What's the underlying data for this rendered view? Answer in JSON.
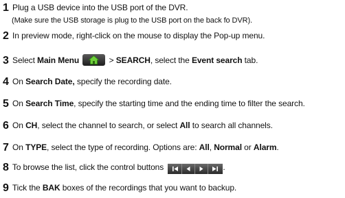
{
  "steps": [
    {
      "num": "1",
      "parts": [
        "Plug a USB device into the USB port of the DVR."
      ],
      "note": "(Make sure the USB storage is plug to the USB port on the back fo DVR)."
    },
    {
      "num": "2",
      "parts": [
        "In preview mode, right-click on the mouse to display the Pop-up menu."
      ]
    },
    {
      "num": "3",
      "parts": [
        "Select ",
        "Main Menu",
        " > ",
        "SEARCH",
        ", select the ",
        "Event search",
        " tab."
      ]
    },
    {
      "num": "4",
      "parts": [
        "On ",
        "Search Date,",
        " specify the recording date."
      ]
    },
    {
      "num": "5",
      "parts": [
        "On ",
        "Search Time",
        ", specify the starting time and the ending time to filter the search."
      ]
    },
    {
      "num": "6",
      "parts": [
        "On ",
        "CH",
        ", select the channel to search, or select ",
        "All",
        " to search all channels."
      ]
    },
    {
      "num": "7",
      "parts": [
        "On ",
        "TYPE",
        ", select the type of recording. Options are: ",
        "All",
        ", ",
        "Normal",
        " or ",
        "Alarm",
        "."
      ]
    },
    {
      "num": "8",
      "parts": [
        "To browse the list, click the control buttons",
        "."
      ]
    },
    {
      "num": "9",
      "parts": [
        "Tick the ",
        "BAK",
        " boxes of the recordings that you want to backup."
      ]
    }
  ],
  "icons": {
    "home": "home-icon",
    "controls": [
      "skip-first-icon",
      "previous-icon",
      "next-icon",
      "skip-last-icon"
    ]
  }
}
